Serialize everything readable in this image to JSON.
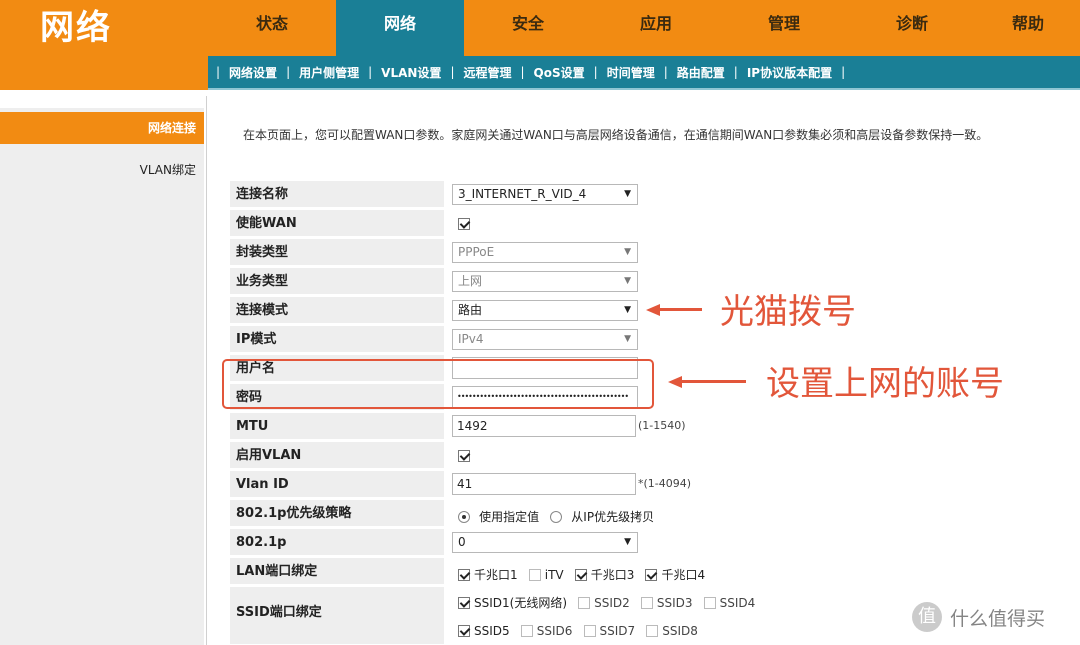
{
  "brand": "网络",
  "main_tabs": [
    "状态",
    "网络",
    "安全",
    "应用",
    "管理",
    "诊断",
    "帮助"
  ],
  "active_main_tab": "网络",
  "sub_tabs": [
    "网络设置",
    "用户侧管理",
    "VLAN设置",
    "远程管理",
    "QoS设置",
    "时间管理",
    "路由配置",
    "IP协议版本配置"
  ],
  "sidebar": [
    "网络连接",
    "VLAN绑定"
  ],
  "intro": "在本页面上，您可以配置WAN口参数。家庭网关通过WAN口与高层网络设备通信，在通信期间WAN口参数集必须和高层设备参数保持一致。",
  "form": {
    "connection_name": {
      "label": "连接名称",
      "value": "3_INTERNET_R_VID_4"
    },
    "enable_wan": {
      "label": "使能WAN",
      "checked": true
    },
    "encap_type": {
      "label": "封装类型",
      "value": "PPPoE"
    },
    "service_type": {
      "label": "业务类型",
      "value": "上网"
    },
    "connection_mode": {
      "label": "连接模式",
      "value": "路由"
    },
    "ip_mode": {
      "label": "IP模式",
      "value": "IPv4"
    },
    "username": {
      "label": "用户名",
      "value": ""
    },
    "password": {
      "label": "密码",
      "value": "••••••••••••••••••••••••••••••••••••••••••••••"
    },
    "mtu": {
      "label": "MTU",
      "value": "1492",
      "hint": "(1-1540)"
    },
    "enable_vlan": {
      "label": "启用VLAN",
      "checked": true
    },
    "vlan_id": {
      "label": "Vlan ID",
      "value": "41",
      "hint": "*(1-4094)"
    },
    "priority_policy": {
      "label": "802.1p优先级策略",
      "options": [
        "使用指定值",
        "从IP优先级拷贝"
      ],
      "selected": "使用指定值"
    },
    "p8021": {
      "label": "802.1p",
      "value": "0"
    },
    "lan_bind": {
      "label": "LAN端口绑定",
      "ports": [
        {
          "name": "千兆口1",
          "checked": true
        },
        {
          "name": "iTV",
          "checked": false
        },
        {
          "name": "千兆口3",
          "checked": true
        },
        {
          "name": "千兆口4",
          "checked": true
        }
      ]
    },
    "ssid_bind": {
      "label": "SSID端口绑定",
      "ssids": [
        {
          "name": "SSID1(无线网络)",
          "checked": true
        },
        {
          "name": "SSID2",
          "checked": false
        },
        {
          "name": "SSID3",
          "checked": false
        },
        {
          "name": "SSID4",
          "checked": false
        },
        {
          "name": "SSID5",
          "checked": true
        },
        {
          "name": "SSID6",
          "checked": false
        },
        {
          "name": "SSID7",
          "checked": false
        },
        {
          "name": "SSID8",
          "checked": false
        }
      ]
    }
  },
  "annotations": {
    "modem_dial": "光猫拨号",
    "set_account": "设置上网的账号"
  },
  "watermark": {
    "icon": "值",
    "text": "什么值得买"
  },
  "colors": {
    "orange": "#f28b12",
    "teal": "#1a7f96",
    "annotation_red": "#e2563a"
  }
}
